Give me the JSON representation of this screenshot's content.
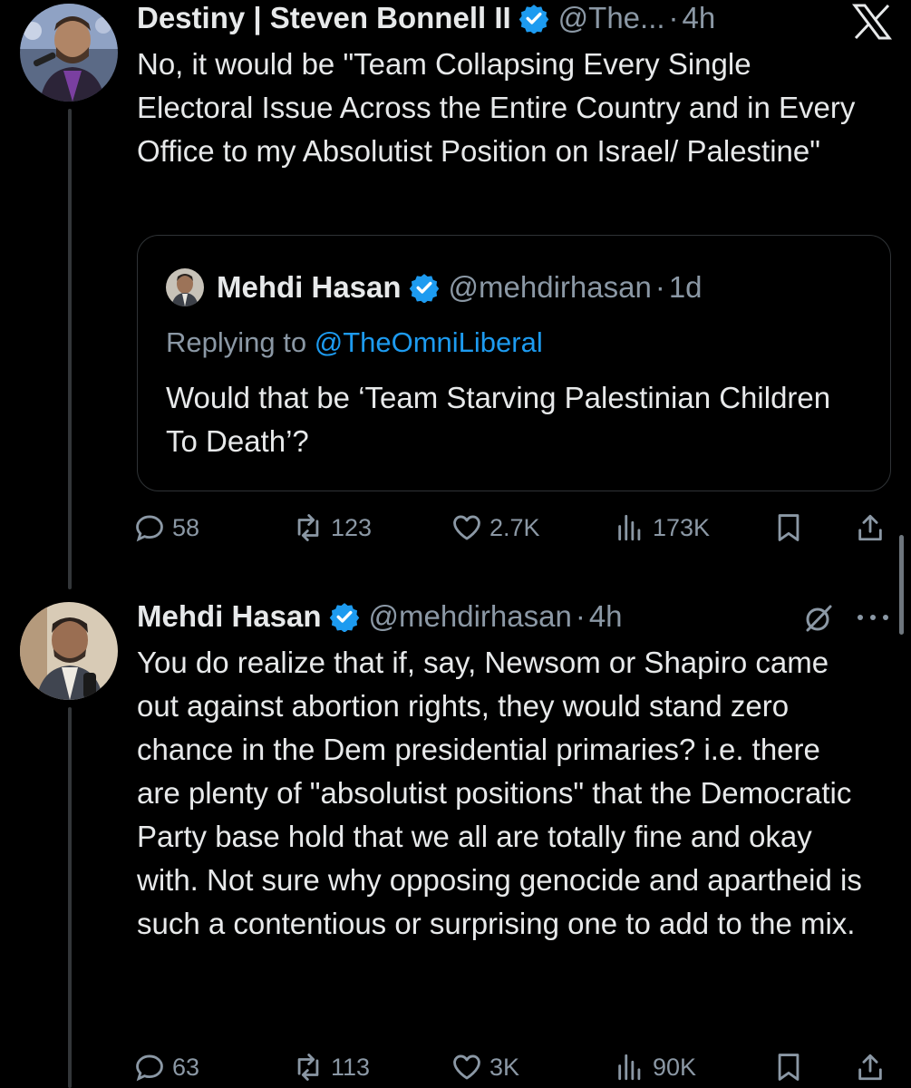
{
  "app": {
    "logo_icon": "x-logo-icon"
  },
  "colors": {
    "background": "#000000",
    "text": "#e7e9ea",
    "muted": "#8b98a5",
    "link": "#1d9bf0",
    "verified": "#1d9bf0",
    "border": "#2f3336"
  },
  "tweets": [
    {
      "author_name": "Destiny | Steven Bonnell II",
      "handle": "@The...",
      "separator": "·",
      "time": "4h",
      "text": "No, it would be \"Team Collapsing Every Single Electoral Issue Across the Entire Country and in Every Office to my Absolutist Position on Israel/ Palestine\"",
      "quote": {
        "author_name": "Mehdi Hasan",
        "handle": "@mehdirhasan",
        "separator": "·",
        "time": "1d",
        "replying_label": "Replying to",
        "replying_to": "@TheOmniLiberal",
        "text": "Would that be ‘Team Starving Palestinian Children To Death’?"
      },
      "stats": {
        "replies": "58",
        "reposts": "123",
        "likes": "2.7K",
        "views": "173K"
      }
    },
    {
      "author_name": "Mehdi Hasan",
      "handle": "@mehdirhasan",
      "separator": "·",
      "time": "4h",
      "text": "You do realize that if, say, Newsom or Shapiro came out against abortion rights, they would stand zero chance in the Dem presidential primaries? i.e. there are plenty of \"absolutist positions\" that the Democratic Party base hold that we all are totally fine and okay with. Not sure why opposing genocide and apartheid is such a contentious or surprising one to add to the mix.",
      "stats": {
        "replies": "63",
        "reposts": "113",
        "likes": "3K",
        "views": "90K"
      }
    }
  ]
}
